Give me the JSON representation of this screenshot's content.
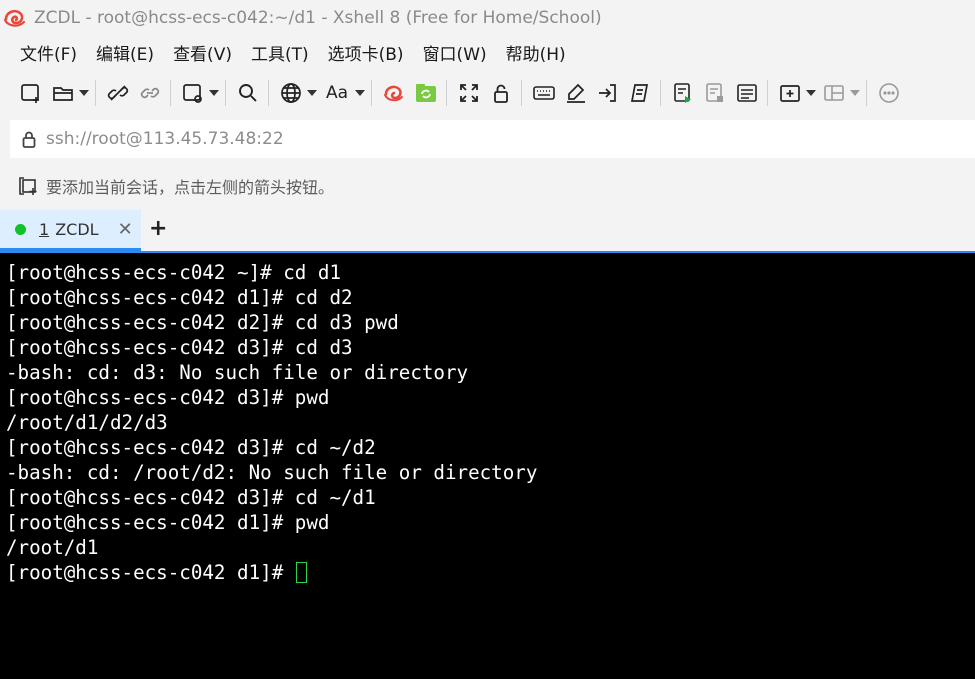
{
  "window": {
    "title": "ZCDL - root@hcss-ecs-c042:~/d1 - Xshell 8 (Free for Home/School)"
  },
  "menu": [
    {
      "label": "文件(F)"
    },
    {
      "label": "编辑(E)"
    },
    {
      "label": "查看(V)"
    },
    {
      "label": "工具(T)"
    },
    {
      "label": "选项卡(B)"
    },
    {
      "label": "窗口(W)"
    },
    {
      "label": "帮助(H)"
    }
  ],
  "toolbar": {
    "font_button_label": "Aa"
  },
  "address": {
    "value": "ssh://root@113.45.73.48:22"
  },
  "hint": {
    "text": "要添加当前会话，点击左侧的箭头按钮。"
  },
  "tabs": [
    {
      "number": "1",
      "label": "ZCDL",
      "status_color": "#10c22a",
      "close": "✕"
    }
  ],
  "tab_add_label": "+",
  "terminal": {
    "lines": [
      "[root@hcss-ecs-c042 ~]# cd d1",
      "[root@hcss-ecs-c042 d1]# cd d2",
      "[root@hcss-ecs-c042 d2]# cd d3 pwd",
      "[root@hcss-ecs-c042 d3]# cd d3",
      "-bash: cd: d3: No such file or directory",
      "[root@hcss-ecs-c042 d3]# pwd",
      "/root/d1/d2/d3",
      "[root@hcss-ecs-c042 d3]# cd ~/d2",
      "-bash: cd: /root/d2: No such file or directory",
      "[root@hcss-ecs-c042 d3]# cd ~/d1",
      "[root@hcss-ecs-c042 d1]# pwd",
      "/root/d1"
    ],
    "prompt": "[root@hcss-ecs-c042 d1]# "
  },
  "colors": {
    "accent": "#2a8bf2",
    "terminal_bg": "#000000",
    "terminal_fg": "#ffffff",
    "cursor": "#2fd34a"
  }
}
